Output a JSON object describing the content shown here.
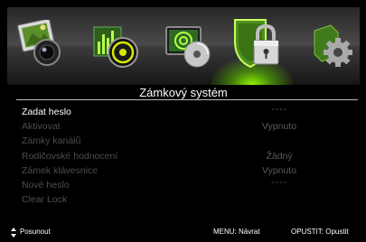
{
  "menu_title": "Zámkový systém",
  "icons": [
    {
      "name": "picture-settings-icon",
      "active": false
    },
    {
      "name": "sound-settings-icon",
      "active": false
    },
    {
      "name": "channel-settings-icon",
      "active": false
    },
    {
      "name": "lock-system-icon",
      "active": true
    },
    {
      "name": "setup-gear-icon",
      "active": false
    }
  ],
  "items": [
    {
      "label": "Zadat heslo",
      "value": "----",
      "active": true
    },
    {
      "label": "Aktivovat",
      "value": "Vypnuto",
      "active": false
    },
    {
      "label": "Zámky kanálů",
      "value": "",
      "active": false
    },
    {
      "label": "Rodičovské hodnocení",
      "value": "Žádný",
      "active": false
    },
    {
      "label": "Zámek klávesnice",
      "value": "Vypnuto",
      "active": false
    },
    {
      "label": "Nové heslo",
      "value": "----",
      "active": false
    },
    {
      "label": "Clear Lock",
      "value": "",
      "active": false
    }
  ],
  "footer": {
    "move_label": "Posunout",
    "menu_hint": "MENU: Návrat",
    "exit_hint": "OPUSTIT: Opustit"
  },
  "colors": {
    "active_highlight": "#8fe600",
    "active_text": "#ffffff",
    "inactive_text": "#4d4d4d",
    "background": "#000000"
  }
}
